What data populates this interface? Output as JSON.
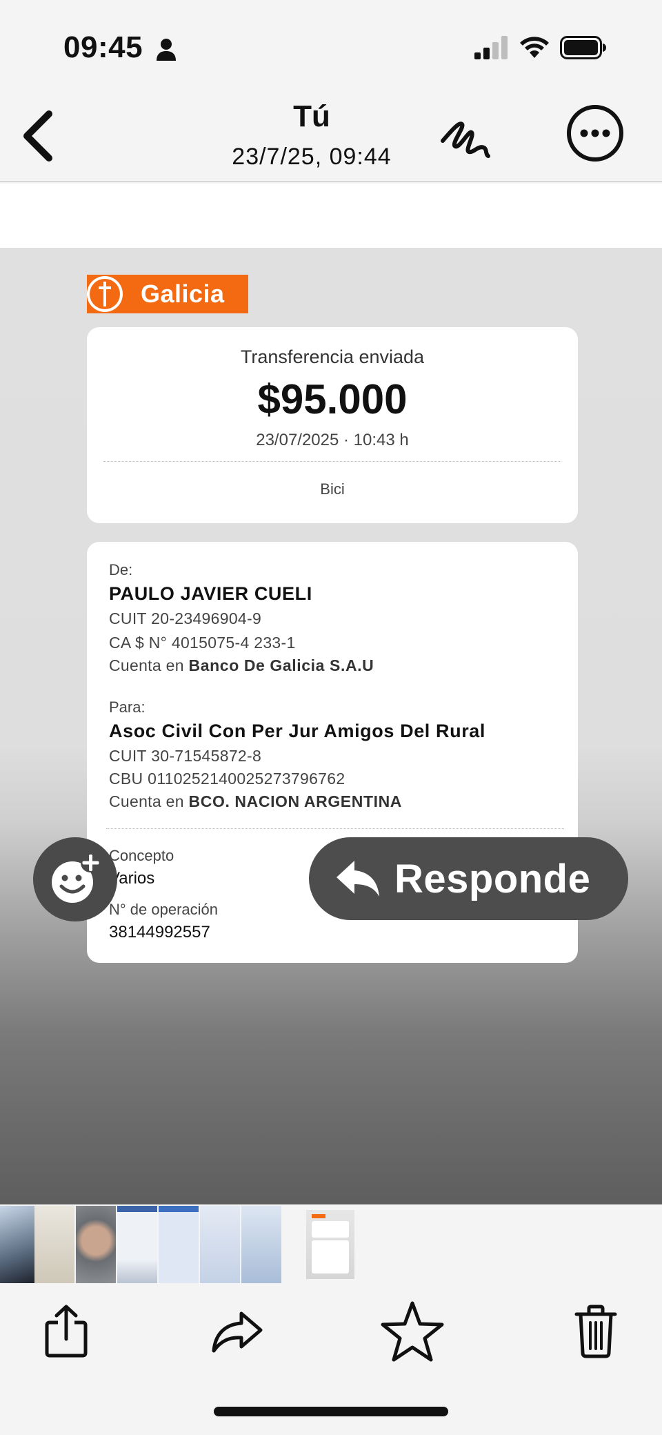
{
  "status_bar": {
    "time": "09:45"
  },
  "nav": {
    "title": "Tú",
    "subtitle": "23/7/25, 09:44"
  },
  "receipt": {
    "brand": "Galicia",
    "summary": {
      "type": "Transferencia enviada",
      "amount": "$95.000",
      "datetime": "23/07/2025 · 10:43 h",
      "note": "Bici"
    },
    "from": {
      "label": "De:",
      "name": "PAULO JAVIER CUELI",
      "cuit": "CUIT 20-23496904-9",
      "account": "CA $ N° 4015075-4 233-1",
      "bank_prefix": "Cuenta en",
      "bank": "Banco De Galicia S.A.U"
    },
    "to": {
      "label": "Para:",
      "name": "Asoc Civil Con Per Jur Amigos Del Rural",
      "cuit": "CUIT 30-71545872-8",
      "cbu": "CBU 0110252140025273796762",
      "bank_prefix": "Cuenta en",
      "bank": "BCO. NACION ARGENTINA"
    },
    "concept": {
      "label": "Concepto",
      "value": "Varios"
    },
    "operation": {
      "label": "N° de operación",
      "value": "38144992557"
    }
  },
  "overlay": {
    "reply_label": "Responde"
  },
  "toolbar": {
    "share_icon": "share-icon",
    "forward_icon": "forward-arrow-icon",
    "favorite_icon": "star-icon",
    "delete_icon": "trash-icon"
  },
  "colors": {
    "brand_orange": "#f46a12",
    "overlay_button": "#4d4d4d"
  }
}
